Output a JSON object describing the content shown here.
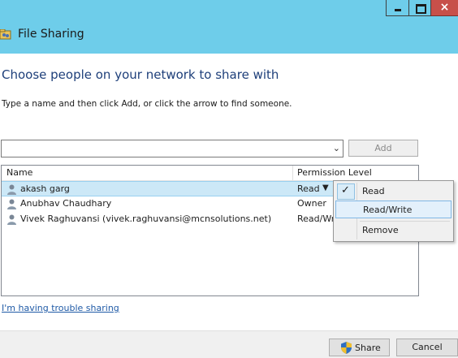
{
  "window": {
    "title": "File Sharing",
    "close_glyph": "×"
  },
  "main": {
    "heading": "Choose people on your network to share with",
    "instructions": "Type a name and then click Add, or click the arrow to find someone.",
    "name_input": {
      "value": ""
    },
    "add_label": "Add"
  },
  "list": {
    "columns": {
      "name": "Name",
      "permission": "Permission Level"
    },
    "rows": [
      {
        "name": "akash garg",
        "permission": "Read"
      },
      {
        "name": "Anubhav Chaudhary",
        "permission": "Owner"
      },
      {
        "name": "Vivek Raghuvansi (vivek.raghuvansi@mcnsolutions.net)",
        "permission": "Read/Wr"
      }
    ]
  },
  "permission_menu": {
    "items": [
      {
        "label": "Read",
        "checked": true
      },
      {
        "label": "Read/Write"
      },
      {
        "label": "Remove"
      }
    ]
  },
  "links": {
    "trouble": "I'm having trouble sharing"
  },
  "footer": {
    "share_label": "Share",
    "cancel_label": "Cancel"
  },
  "colors": {
    "title_bar": "#6ecdea",
    "close_button": "#c7504a",
    "heading_text": "#1e3f7a",
    "selection": "#cce8f7",
    "link": "#1f5aa6"
  }
}
